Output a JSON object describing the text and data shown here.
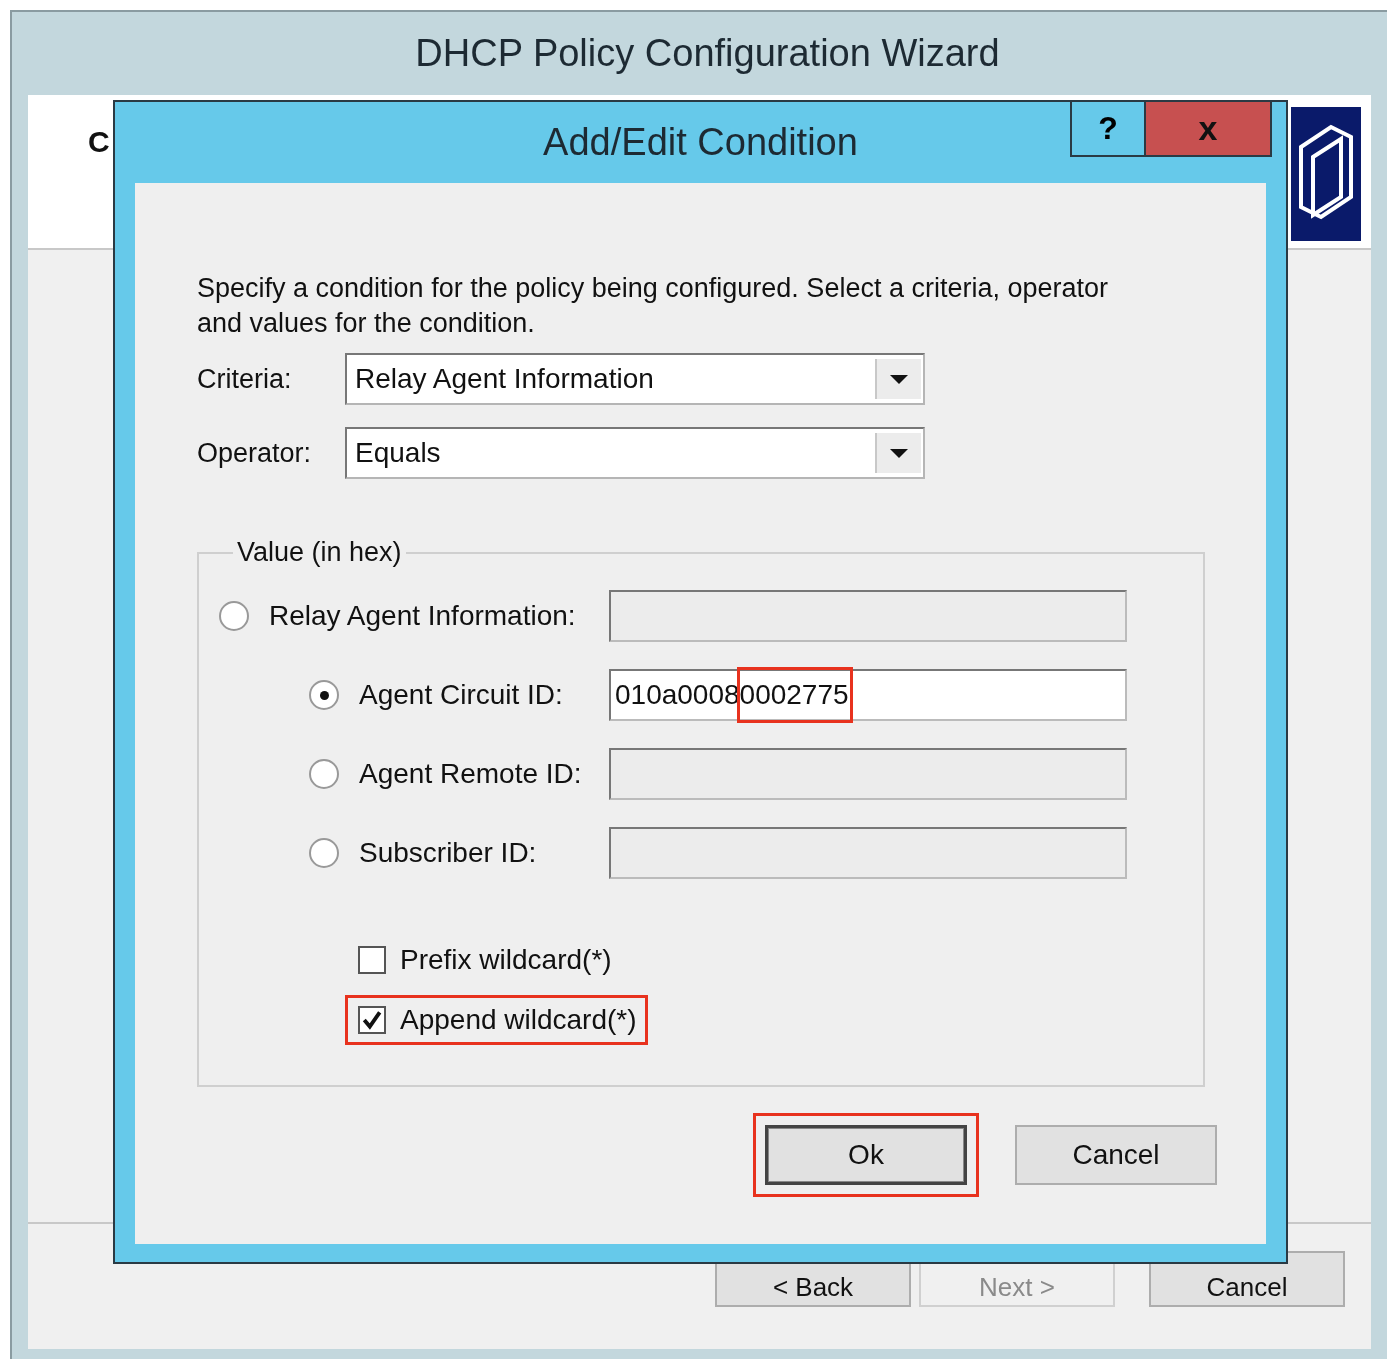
{
  "wizard": {
    "title": "DHCP Policy Configuration Wizard",
    "header_text": "C",
    "buttons": [
      {
        "label": "< Back",
        "disabled": false
      },
      {
        "label": "Next >",
        "disabled": true
      },
      {
        "label": "Cancel",
        "disabled": false
      }
    ]
  },
  "dialog": {
    "title": "Add/Edit Condition",
    "help_label": "?",
    "close_label": "x",
    "description": "Specify a condition for the policy being configured. Select a criteria, operator and values for the condition.",
    "fields": [
      {
        "label": "Criteria:",
        "value": "Relay Agent Information"
      },
      {
        "label": "Operator:",
        "value": "Equals"
      }
    ],
    "group": {
      "legend": "Value (in hex)",
      "options": [
        {
          "label": "Relay Agent Information:",
          "selected": false,
          "children": [
            {
              "label": "Agent Circuit ID:",
              "value": "010a00080002775",
              "selected": true,
              "value_highlighted": true
            },
            {
              "label": "Agent Remote ID:",
              "selected": false
            },
            {
              "label": "Subscriber ID:",
              "selected": false
            }
          ]
        }
      ],
      "checkboxes": [
        {
          "label": "Prefix wildcard(*)",
          "checked": false,
          "highlighted": false
        },
        {
          "label": "Append wildcard(*)",
          "checked": true,
          "highlighted": true
        }
      ]
    },
    "buttons": [
      {
        "label": "Ok",
        "default": true,
        "highlighted": true
      },
      {
        "label": "Cancel",
        "default": false,
        "highlighted": false
      }
    ]
  }
}
